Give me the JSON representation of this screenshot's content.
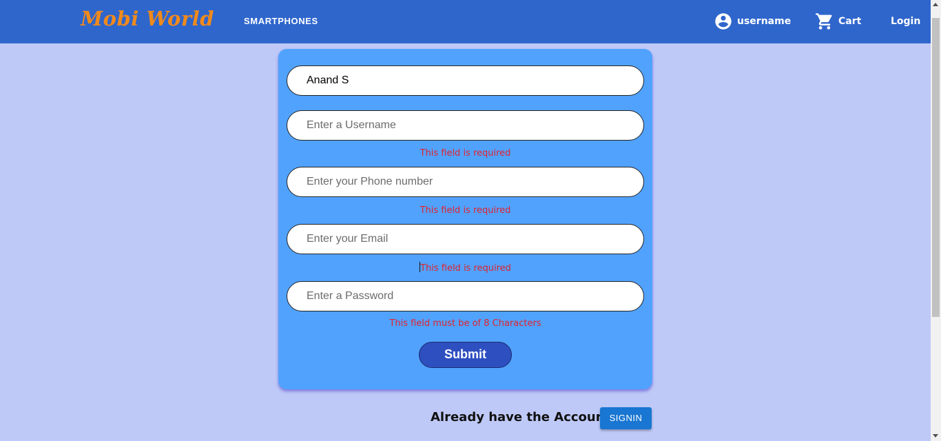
{
  "navbar": {
    "brand": "Mobi World",
    "nav_link": "SMARTPHONES",
    "user_label": "username",
    "cart_label": "Cart",
    "login_label": "Login",
    "user_icon": "account-circle-icon",
    "cart_icon": "shopping-cart-icon"
  },
  "form": {
    "name_value": "Anand S",
    "username_placeholder": "Enter a Username",
    "phone_placeholder": "Enter your Phone number",
    "email_placeholder": "Enter your Email",
    "password_placeholder": "Enter a Password",
    "username_error": "This field is required",
    "phone_error": "This field is required",
    "email_error": "This field is required",
    "password_error": "This field must be of 8 Characters",
    "submit_label": "Submit"
  },
  "footer": {
    "already_text": "Already have the Account?",
    "signin_label": "SIGNIN"
  },
  "colors": {
    "navbar": "#2f66cc",
    "background": "#bec9f7",
    "card": "#51a2fd",
    "brand": "#f08a1c",
    "error": "#e0232d",
    "submit": "#2e4fc0",
    "signin": "#1976d2"
  }
}
